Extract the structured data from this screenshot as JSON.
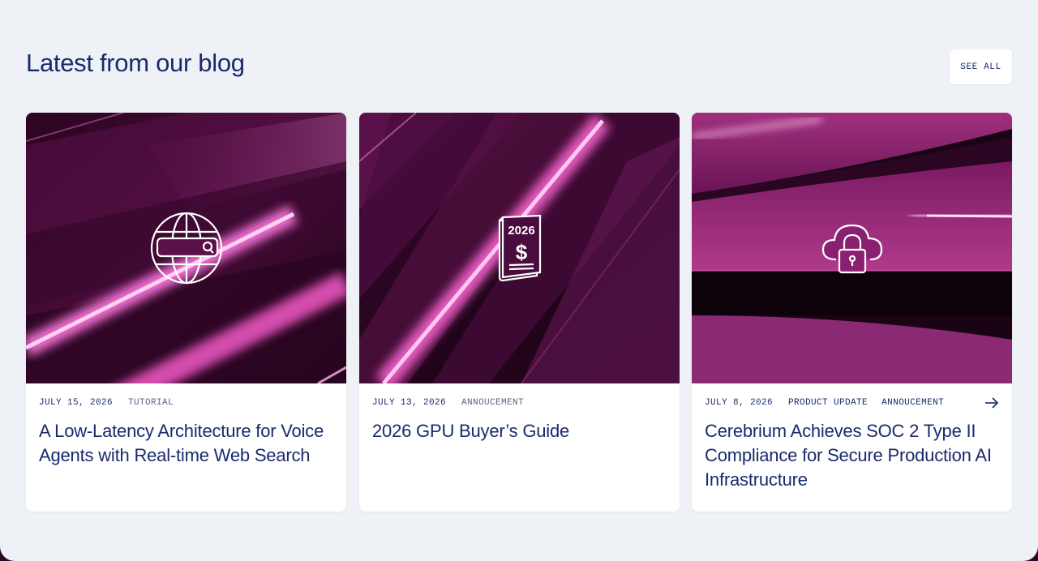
{
  "section": {
    "title": "Latest from our blog",
    "see_all_label": "SEE ALL"
  },
  "posts": [
    {
      "date": "JULY 15, 2026",
      "tags": [
        "TUTORIAL"
      ],
      "title": "A Low-Latency Architecture for Voice Agents with Real-time Web Search",
      "icon": "globe-search-icon"
    },
    {
      "date": "JULY 13, 2026",
      "tags": [
        "ANNOUCEMENT"
      ],
      "title": "2026 GPU Buyer’s Guide",
      "icon": "book-dollar-icon",
      "icon_text": "2026"
    },
    {
      "date": "JULY 8, 2026",
      "tags": [
        "PRODUCT UPDATE",
        "ANNOUCEMENT"
      ],
      "title": "Cerebrium Achieves SOC 2 Type II Compliance for Secure Production AI Infrastructure",
      "icon": "cloud-lock-icon",
      "has_arrow": true
    }
  ],
  "colors": {
    "background": "#eef1f5",
    "text": "#1a2a6c",
    "muted": "#5a6585",
    "accent_magenta": "#c0268f"
  }
}
